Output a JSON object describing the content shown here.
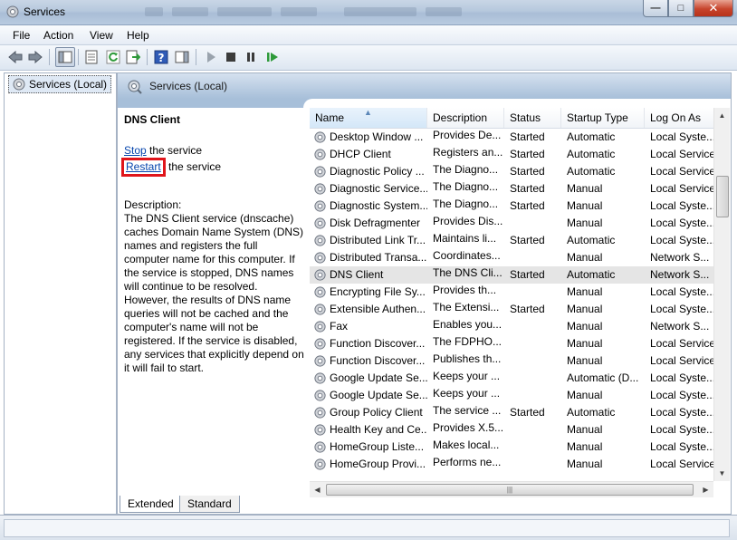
{
  "window": {
    "title": "Services"
  },
  "menu": [
    "File",
    "Action",
    "View",
    "Help"
  ],
  "tree": {
    "root_label": "Services (Local)"
  },
  "main_header": {
    "title": "Services (Local)"
  },
  "details": {
    "service_name": "DNS Client",
    "stop_link": "Stop",
    "stop_suffix": " the service",
    "restart_link": "Restart",
    "restart_suffix": " the service",
    "description_heading": "Description:",
    "description_text": "The DNS Client service (dnscache) caches Domain Name System (DNS) names and registers the full computer name for this computer. If the service is stopped, DNS names will continue to be resolved. However, the results of DNS name queries will not be cached and the computer's name will not be registered. If the service is disabled, any services that explicitly depend on it will fail to start."
  },
  "table": {
    "columns": [
      "Name",
      "Description",
      "Status",
      "Startup Type",
      "Log On As"
    ],
    "rows": [
      {
        "name": "Desktop Window ...",
        "desc": "Provides De...",
        "status": "Started",
        "startup": "Automatic",
        "logon": "Local Syste..."
      },
      {
        "name": "DHCP Client",
        "desc": "Registers an...",
        "status": "Started",
        "startup": "Automatic",
        "logon": "Local Service"
      },
      {
        "name": "Diagnostic Policy ...",
        "desc": "The Diagno...",
        "status": "Started",
        "startup": "Automatic",
        "logon": "Local Service"
      },
      {
        "name": "Diagnostic Service...",
        "desc": "The Diagno...",
        "status": "Started",
        "startup": "Manual",
        "logon": "Local Service"
      },
      {
        "name": "Diagnostic System...",
        "desc": "The Diagno...",
        "status": "Started",
        "startup": "Manual",
        "logon": "Local Syste..."
      },
      {
        "name": "Disk Defragmenter",
        "desc": "Provides Dis...",
        "status": "",
        "startup": "Manual",
        "logon": "Local Syste..."
      },
      {
        "name": "Distributed Link Tr...",
        "desc": "Maintains li...",
        "status": "Started",
        "startup": "Automatic",
        "logon": "Local Syste..."
      },
      {
        "name": "Distributed Transa...",
        "desc": "Coordinates...",
        "status": "",
        "startup": "Manual",
        "logon": "Network S..."
      },
      {
        "name": "DNS Client",
        "desc": "The DNS Cli...",
        "status": "Started",
        "startup": "Automatic",
        "logon": "Network S..."
      },
      {
        "name": "Encrypting File Sy...",
        "desc": "Provides th...",
        "status": "",
        "startup": "Manual",
        "logon": "Local Syste..."
      },
      {
        "name": "Extensible Authen...",
        "desc": "The Extensi...",
        "status": "Started",
        "startup": "Manual",
        "logon": "Local Syste..."
      },
      {
        "name": "Fax",
        "desc": "Enables you...",
        "status": "",
        "startup": "Manual",
        "logon": "Network S..."
      },
      {
        "name": "Function Discover...",
        "desc": "The FDPHO...",
        "status": "",
        "startup": "Manual",
        "logon": "Local Service"
      },
      {
        "name": "Function Discover...",
        "desc": "Publishes th...",
        "status": "",
        "startup": "Manual",
        "logon": "Local Service"
      },
      {
        "name": "Google Update Se...",
        "desc": "Keeps your ...",
        "status": "",
        "startup": "Automatic (D...",
        "logon": "Local Syste..."
      },
      {
        "name": "Google Update Se...",
        "desc": "Keeps your ...",
        "status": "",
        "startup": "Manual",
        "logon": "Local Syste..."
      },
      {
        "name": "Group Policy Client",
        "desc": "The service ...",
        "status": "Started",
        "startup": "Automatic",
        "logon": "Local Syste..."
      },
      {
        "name": "Health Key and Ce...",
        "desc": "Provides X.5...",
        "status": "",
        "startup": "Manual",
        "logon": "Local Syste..."
      },
      {
        "name": "HomeGroup Liste...",
        "desc": "Makes local...",
        "status": "",
        "startup": "Manual",
        "logon": "Local Syste..."
      },
      {
        "name": "HomeGroup Provi...",
        "desc": "Performs ne...",
        "status": "",
        "startup": "Manual",
        "logon": "Local Service"
      }
    ]
  },
  "tabs": [
    "Extended",
    "Standard"
  ],
  "colors": {
    "accent": "#0645ad",
    "highlight": "#e0151b",
    "header": "#a7bfd9"
  }
}
